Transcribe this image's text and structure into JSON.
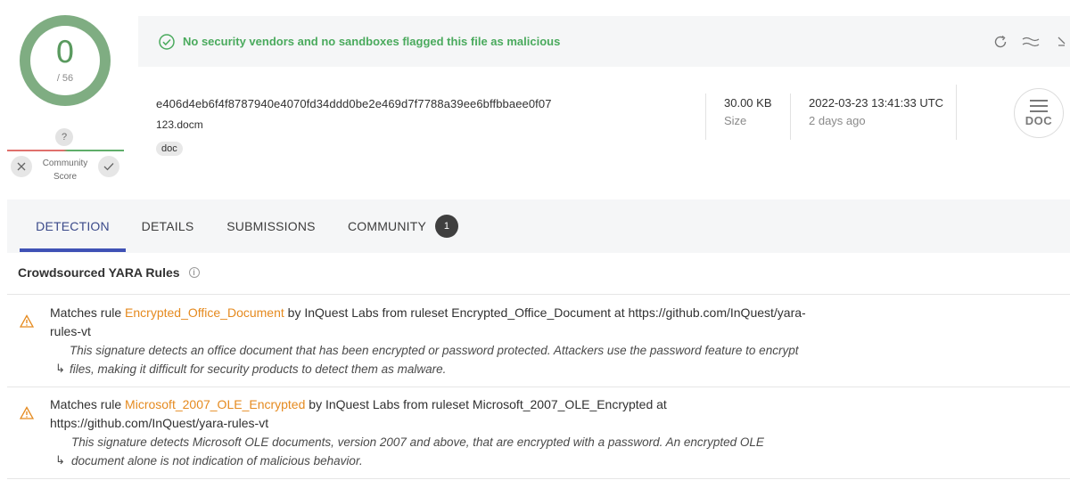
{
  "score": {
    "positives": "0",
    "total": "/ 56"
  },
  "community": {
    "question": "?",
    "label": "Community Score"
  },
  "status": {
    "text": "No security vendors and no sandboxes flagged this file as malicious",
    "color": "#4aaa5d"
  },
  "file": {
    "hash": "e406d4eb6f4f8787940e4070fd34ddd0be2e469d7f7788a39ee6bffbbaee0f07",
    "name": "123.docm",
    "tag": "doc",
    "size_value": "30.00 KB",
    "size_label": "Size",
    "date_value": "2022-03-23 13:41:33 UTC",
    "date_label": "2 days ago",
    "type_icon": "DOC"
  },
  "tabs": [
    {
      "label": "DETECTION"
    },
    {
      "label": "DETAILS"
    },
    {
      "label": "SUBMISSIONS"
    },
    {
      "label": "COMMUNITY",
      "badge": "1"
    }
  ],
  "section": {
    "title": "Crowdsourced YARA Rules",
    "info": "i"
  },
  "rules": [
    {
      "prefix": "Matches rule ",
      "rule": "Encrypted_Office_Document",
      "suffix": " by InQuest Labs from ruleset Encrypted_Office_Document at https://github.com/InQuest/yara-rules-vt",
      "description": "This signature detects an office document that has been encrypted or password protected. Attackers use the password feature to encrypt files, making it difficult for security products to detect them as malware."
    },
    {
      "prefix": "Matches rule ",
      "rule": "Microsoft_2007_OLE_Encrypted",
      "suffix": " by InQuest Labs from ruleset Microsoft_2007_OLE_Encrypted at https://github.com/InQuest/yara-rules-vt",
      "description": "This signature detects Microsoft OLE documents, version 2007 and above, that are encrypted with a password. An encrypted OLE document alone is not indication of malicious behavior."
    }
  ],
  "colors": {
    "accent": "#3f51b5",
    "warning": "#e58a1f",
    "good": "#5a9a5f"
  }
}
